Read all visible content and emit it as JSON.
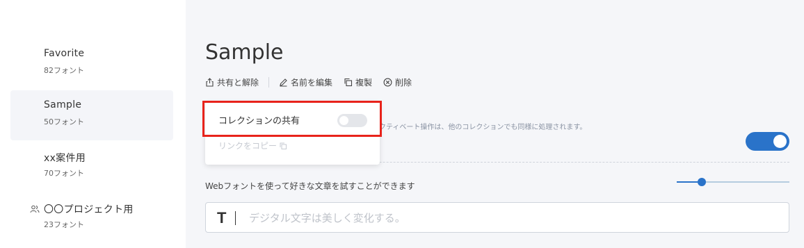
{
  "sidebar": {
    "collections": [
      {
        "name": "Favorite",
        "count": "82フォント",
        "shared": false,
        "active": false
      },
      {
        "name": "Sample",
        "count": "50フォント",
        "shared": false,
        "active": true
      },
      {
        "name": "xx案件用",
        "count": "70フォント",
        "shared": false,
        "active": false
      },
      {
        "name": "〇〇プロジェクト用",
        "count": "23フォント",
        "shared": true,
        "active": false
      }
    ]
  },
  "main": {
    "title": "Sample",
    "actions": {
      "share": "共有と解除",
      "rename": "名前を編集",
      "duplicate": "複製",
      "delete": "削除"
    },
    "description_partial": "クティベート操作は、他のコレクションでも同様に処理されます。",
    "main_toggle_on": true,
    "webfont_description": "Webフォントを使って好きな文章を試すことができます",
    "slider_level": 0.22,
    "sample_input": {
      "placeholder": "デジタル文字は美しく変化する。",
      "value": ""
    }
  },
  "popup": {
    "share_label": "コレクションの共有",
    "share_toggle_on": false,
    "copy_link": "リンクをコピー"
  },
  "colors": {
    "accent": "#2a73c9",
    "highlight": "#e8231b"
  }
}
